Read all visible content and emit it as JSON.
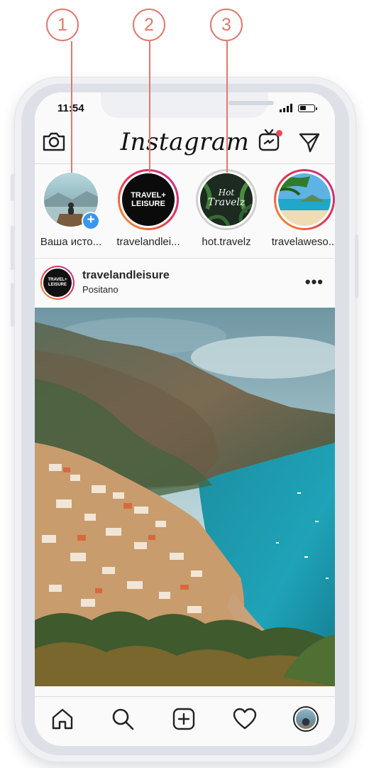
{
  "callouts": [
    "1",
    "2",
    "3"
  ],
  "status_bar": {
    "time": "11:54"
  },
  "header": {
    "logo_text": "Instagram",
    "camera_icon": "camera-icon",
    "igtv_icon": "igtv-icon",
    "direct_icon": "direct-message-icon",
    "notification_color": "#ed4956"
  },
  "stories": [
    {
      "label": "Ваша исто...",
      "ring": "none",
      "has_add_badge": true,
      "add_symbol": "+"
    },
    {
      "label": "travelandlei...",
      "ring": "gradient",
      "avatar_text": "TRAVEL+ LEISURE"
    },
    {
      "label": "hot.travelz",
      "ring": "seen",
      "avatar_text_1": "Hot",
      "avatar_text_2": "Travelz"
    },
    {
      "label": "travelaweso...",
      "ring": "gradient"
    }
  ],
  "post": {
    "username": "travelandleisure",
    "location": "Positano",
    "avatar_text": "TRAVEL+ LEISURE",
    "more_label": "•••"
  },
  "bottom_nav": [
    "home-icon",
    "search-icon",
    "new-post-icon",
    "activity-heart-icon",
    "profile-avatar"
  ],
  "colors": {
    "callout": "#e3776b",
    "story_gradient": [
      "#f9a12b",
      "#e5304f",
      "#c42f96"
    ],
    "add_badge": "#3897f0"
  }
}
